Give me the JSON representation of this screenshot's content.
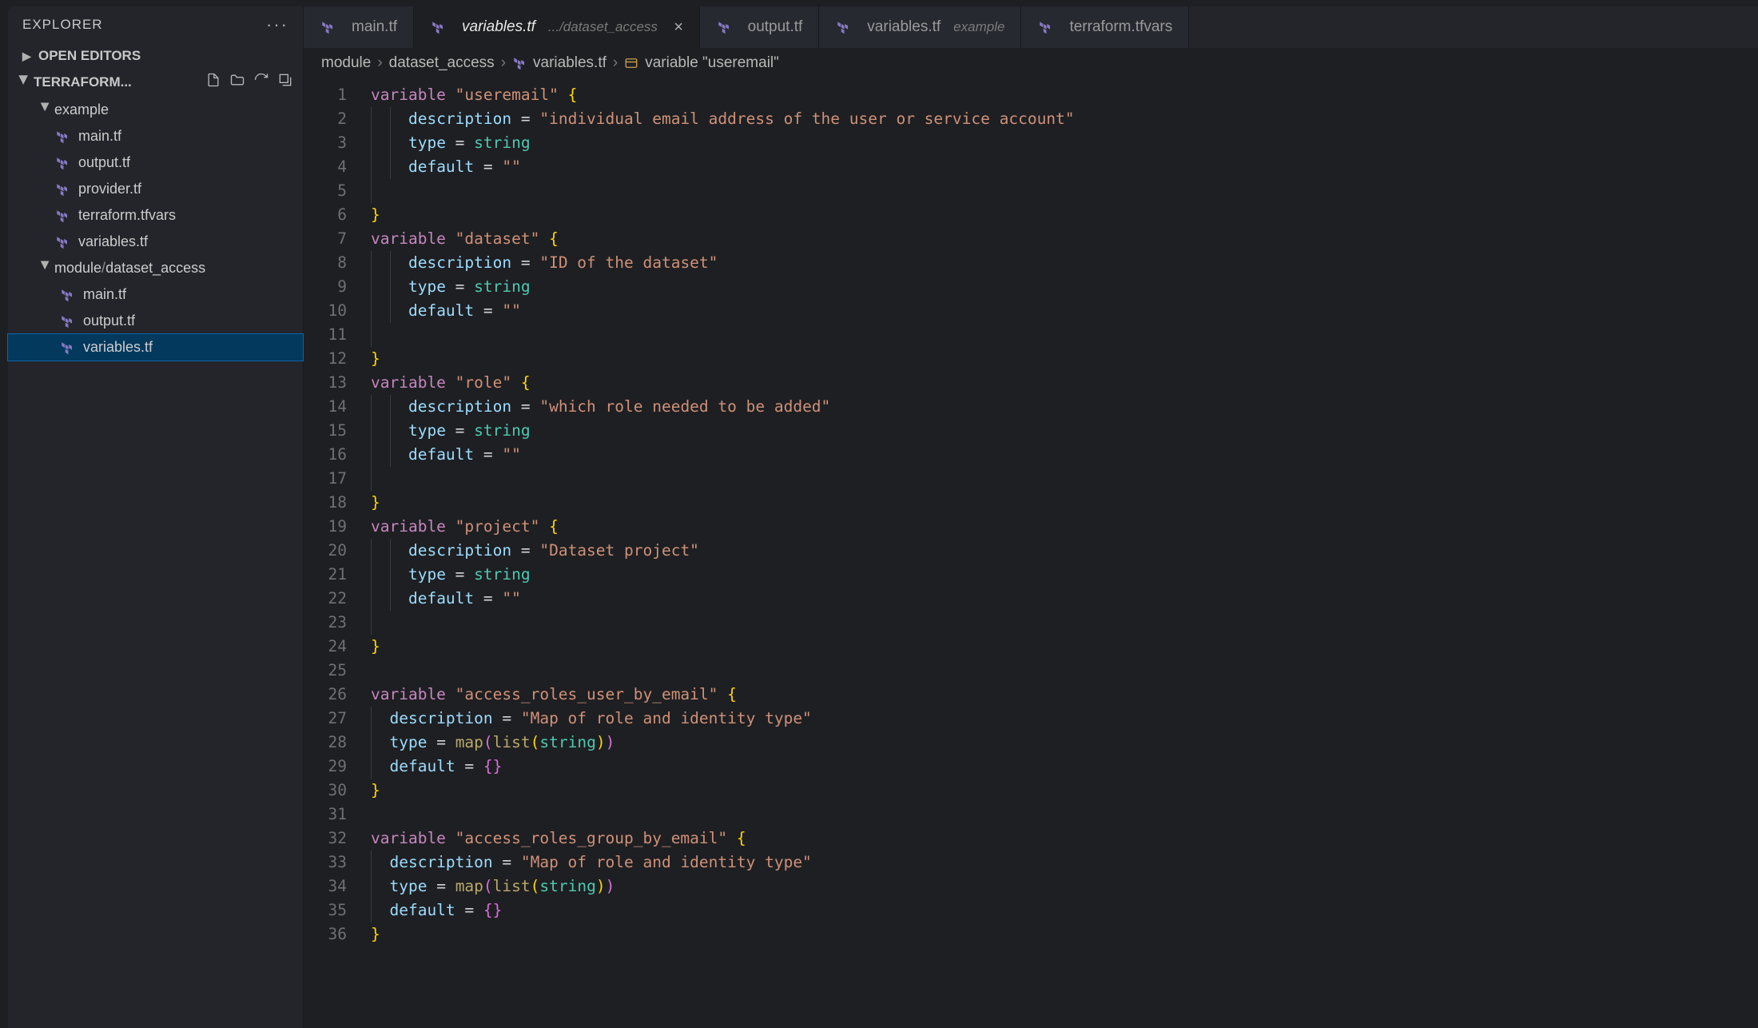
{
  "sidebar": {
    "title": "EXPLORER",
    "openEditors": "OPEN EDITORS",
    "project": "TERRAFORM...",
    "folders": {
      "example": "example",
      "module": "module",
      "dataset_access": "dataset_access"
    },
    "files": {
      "main": "main.tf",
      "output": "output.tf",
      "provider": "provider.tf",
      "tfvars": "terraform.tfvars",
      "variables": "variables.tf"
    }
  },
  "tabs": [
    {
      "name": "main.tf"
    },
    {
      "name": "variables.tf",
      "sub": ".../dataset_access",
      "active": true
    },
    {
      "name": "output.tf"
    },
    {
      "name": "variables.tf",
      "sub": "example"
    },
    {
      "name": "terraform.tfvars"
    }
  ],
  "breadcrumb": {
    "seg1": "module",
    "seg2": "dataset_access",
    "seg3": "variables.tf",
    "seg4": "variable \"useremail\""
  },
  "code": {
    "kw_variable": "variable",
    "prop_description": "description",
    "prop_type": "type",
    "prop_default": "default",
    "type_string": "string",
    "fn_map": "map",
    "fn_list": "list",
    "var_useremail": "\"useremail\"",
    "var_dataset": "\"dataset\"",
    "var_role": "\"role\"",
    "var_project": "\"project\"",
    "var_access_user": "\"access_roles_user_by_email\"",
    "var_access_group": "\"access_roles_group_by_email\"",
    "desc_useremail": "\"individual email address of the user or service account\"",
    "desc_dataset": "\"ID of the dataset\"",
    "desc_role": "\"which role needed to be added\"",
    "desc_project": "\"Dataset project\"",
    "desc_map": "\"Map of role and identity type\"",
    "empty": "\"\"",
    "empty_map": "{}"
  }
}
